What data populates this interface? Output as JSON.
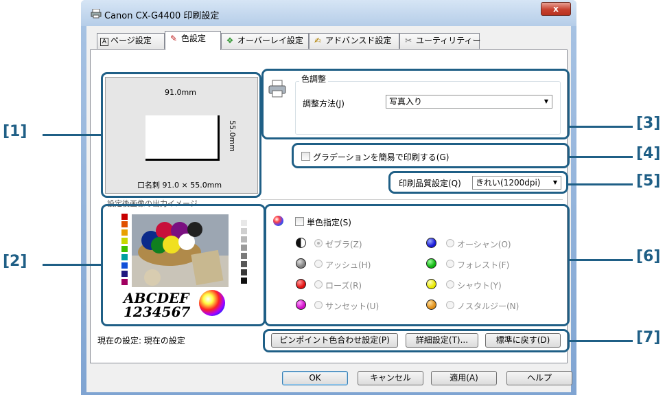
{
  "window": {
    "title": "Canon CX-G4400 印刷設定",
    "close": "x"
  },
  "tabs": [
    {
      "label": "ページ設定",
      "icon": "page-setup-icon"
    },
    {
      "label": "色設定",
      "icon": "color-brush-icon"
    },
    {
      "label": "オーバーレイ設定",
      "icon": "overlay-icon"
    },
    {
      "label": "アドバンスド設定",
      "icon": "advanced-pen-icon"
    },
    {
      "label": "ユーティリティー",
      "icon": "utility-tools-icon"
    }
  ],
  "preview": {
    "width_label": "91.0mm",
    "height_label": "55.0mm",
    "paper_label": "口名刺 91.0 × 55.0mm",
    "output_caption": "設定後画像の出力イメージ",
    "sample_text": "ABCDEF",
    "sample_digits": "1234567"
  },
  "color_adjust": {
    "group_title": "色調整",
    "method_label": "調整方法(J)",
    "method_value": "写真入り"
  },
  "gradation": {
    "label": "グラデーションを簡易で印刷する(G)",
    "checked": false
  },
  "quality": {
    "label": "印刷品質設定(Q)",
    "value": "きれい(1200dpi)"
  },
  "mono": {
    "label": "単色指定(S)",
    "checked": false,
    "options": [
      {
        "label": "ゼブラ(Z)",
        "color": "#111111",
        "selected": true
      },
      {
        "label": "オーシャン(O)",
        "color": "#1a1ad8",
        "selected": false
      },
      {
        "label": "アッシュ(H)",
        "color": "#808080",
        "selected": false
      },
      {
        "label": "フォレスト(F)",
        "color": "#10b410",
        "selected": false
      },
      {
        "label": "ローズ(R)",
        "color": "#e01010",
        "selected": false
      },
      {
        "label": "シャウト(Y)",
        "color": "#e8e800",
        "selected": false
      },
      {
        "label": "サンセット(U)",
        "color": "#d010c8",
        "selected": false
      },
      {
        "label": "ノスタルジー(N)",
        "color": "#e0901a",
        "selected": false
      }
    ]
  },
  "status": {
    "current_settings": "現在の設定: 現在の設定"
  },
  "action_buttons": {
    "pinpoint": "ピンポイント色合わせ設定(P)",
    "detail": "詳細設定(T)...",
    "reset": "標準に戻す(D)"
  },
  "footer_buttons": {
    "ok": "OK",
    "cancel": "キャンセル",
    "apply": "適用(A)",
    "help": "ヘルプ"
  },
  "callouts": [
    "[1]",
    "[2]",
    "[3]",
    "[4]",
    "[5]",
    "[6]",
    "[7]"
  ],
  "colors": {
    "callout": "#1f5f86",
    "window_frame": "#a9c4e4"
  }
}
